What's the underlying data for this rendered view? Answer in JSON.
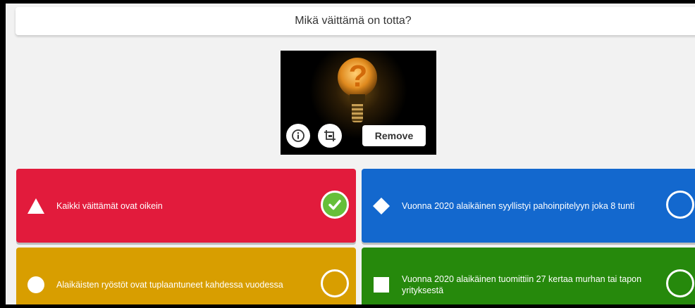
{
  "question": {
    "text": "Mikä väittämä on totta?"
  },
  "media": {
    "image_name": "lightbulb-question-mark",
    "info_icon": "info-icon",
    "crop_icon": "crop-icon",
    "remove_label": "Remove"
  },
  "answers": [
    {
      "shape": "triangle",
      "color": "#e21b3c",
      "text": "Kaikki väittämät ovat oikein",
      "correct": true
    },
    {
      "shape": "diamond",
      "color": "#1368ce",
      "text": "Vuonna 2020 alaikäinen syyllistyi pahoinpitelyyn joka 8 tunti",
      "correct": false
    },
    {
      "shape": "circle",
      "color": "#d89e00",
      "text": "Alaikäisten ryöstöt ovat tuplaantuneet kahdessa vuodessa",
      "correct": false
    },
    {
      "shape": "square",
      "color": "#26890c",
      "text": "Vuonna 2020 alaikäinen tuomittiin 27 kertaa murhan tai tapon yrityksestä",
      "correct": false
    }
  ],
  "colors": {
    "check_green": "#66bf39",
    "background": "#f2f2f2"
  }
}
